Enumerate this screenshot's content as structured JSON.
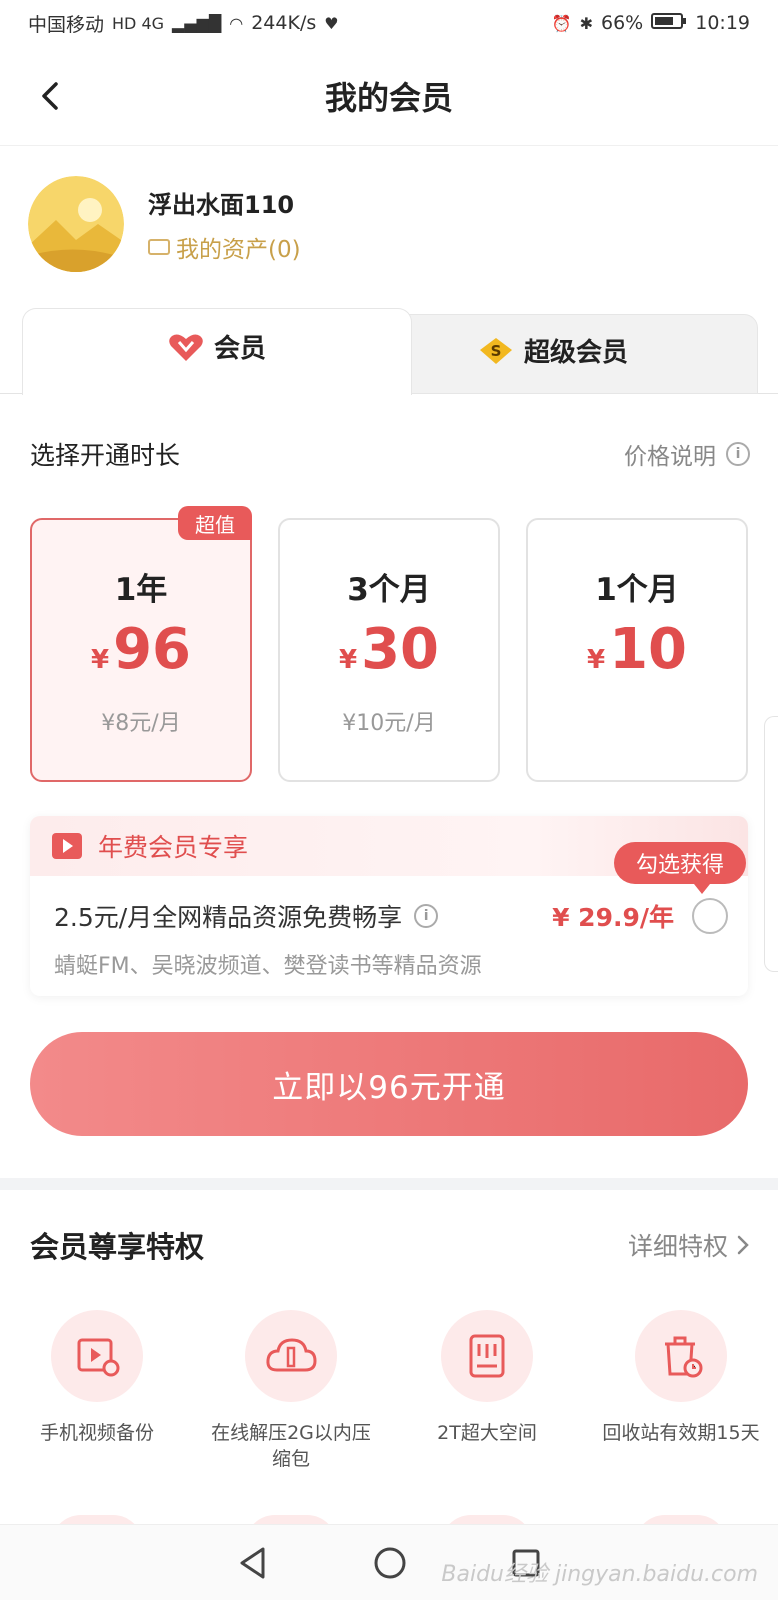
{
  "status_bar": {
    "carrier": "中国移动",
    "network": "HD 4G",
    "speed": "244K/s",
    "battery": "66%",
    "time": "10:19"
  },
  "nav": {
    "title": "我的会员"
  },
  "profile": {
    "username": "浮出水面110",
    "assets_label": "我的资产(0)"
  },
  "tabs": [
    {
      "label": "会员",
      "active": true
    },
    {
      "label": "超级会员",
      "active": false
    }
  ],
  "duration": {
    "title": "选择开通时长",
    "price_note": "价格说明"
  },
  "plans": [
    {
      "name": "1年",
      "currency": "¥",
      "price": "96",
      "monthly": "¥8元/月",
      "badge": "超值",
      "selected": true
    },
    {
      "name": "3个月",
      "currency": "¥",
      "price": "30",
      "monthly": "¥10元/月",
      "selected": false
    },
    {
      "name": "1个月",
      "currency": "¥",
      "price": "10",
      "monthly": "",
      "selected": false
    }
  ],
  "annual": {
    "title": "年费会员专享",
    "check_badge": "勾选获得",
    "description": "2.5元/月全网精品资源免费畅享",
    "price": "¥ 29.9/年",
    "subtext": "蜻蜓FM、吴晓波频道、樊登读书等精品资源"
  },
  "cta": {
    "label": "立即以96元开通"
  },
  "privileges": {
    "title": "会员尊享特权",
    "more": "详细特权",
    "items": [
      {
        "icon": "video-backup-icon",
        "label": "手机视频备份"
      },
      {
        "icon": "cloud-unzip-icon",
        "label": "在线解压2G以内压缩包"
      },
      {
        "icon": "storage-icon",
        "label": "2T超大空间"
      },
      {
        "icon": "recycle-bin-icon",
        "label": "回收站有效期15天"
      }
    ]
  },
  "watermark": "Baidu经验 jingyan.baidu.com",
  "colors": {
    "accent": "#e04e4e",
    "gold": "#c8a04a",
    "cta_start": "#f38a8a",
    "cta_end": "#e86a6a"
  }
}
